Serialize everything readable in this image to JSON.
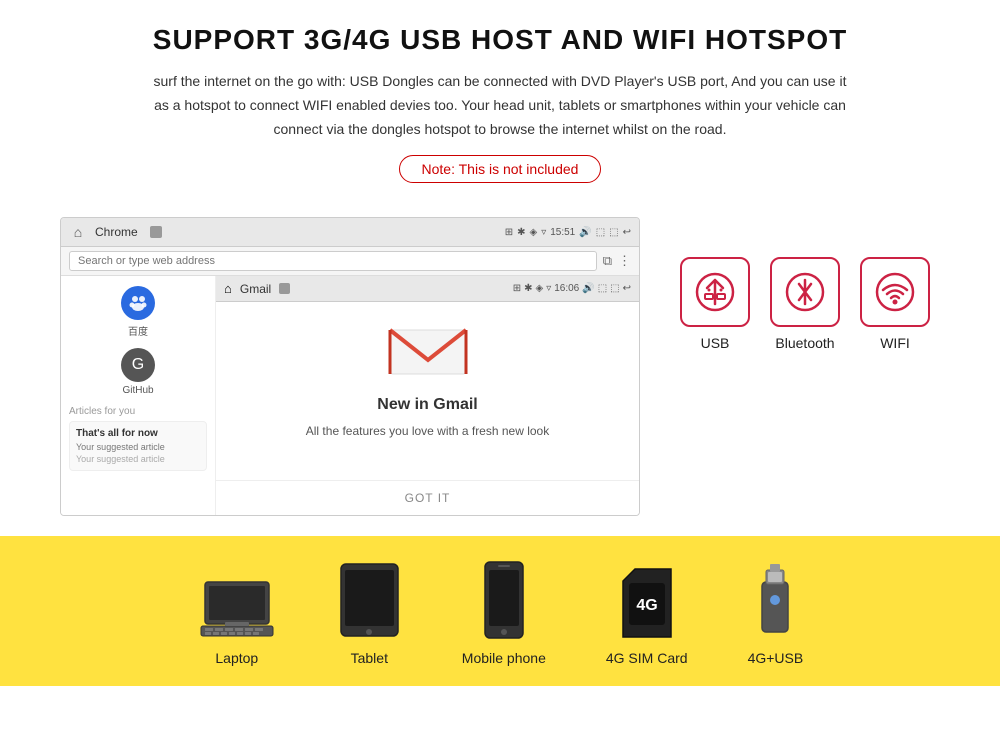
{
  "header": {
    "title": "SUPPORT 3G/4G USB HOST AND WIFI HOTSPOT",
    "subtitle": "surf the internet on the go with: USB Dongles can be connected with DVD Player's USB port, And you can use it as a hotspot to connect WIFI enabled devies too. Your head unit, tablets or smartphones within your vehicle can connect via the dongles hotspot to browse the internet whilst on the road.",
    "note": "Note: This is not included"
  },
  "browser": {
    "tab_label": "Chrome",
    "time": "15:51",
    "address_placeholder": "Search or type web address",
    "gmail_time": "16:06",
    "gmail_label": "Gmail",
    "new_gmail_title": "New in Gmail",
    "new_gmail_desc": "All the features you love with a fresh new look",
    "got_it": "GOT IT",
    "baidu_label": "百度",
    "github_label": "GitHub",
    "articles_label": "Articles for you",
    "suggestion1_title": "That's all for now",
    "suggestion1_desc": "Your suggested article"
  },
  "connectivity": {
    "usb_label": "USB",
    "bluetooth_label": "Bluetooth",
    "wifi_label": "WIFI"
  },
  "devices": [
    {
      "label": "Laptop",
      "type": "laptop"
    },
    {
      "label": "Tablet",
      "type": "tablet"
    },
    {
      "label": "Mobile phone",
      "type": "phone"
    },
    {
      "label": "4G SIM Card",
      "type": "simcard"
    },
    {
      "label": "4G+USB",
      "type": "usb"
    }
  ],
  "colors": {
    "accent_red": "#cc2244",
    "yellow_bg": "#FFE240"
  }
}
